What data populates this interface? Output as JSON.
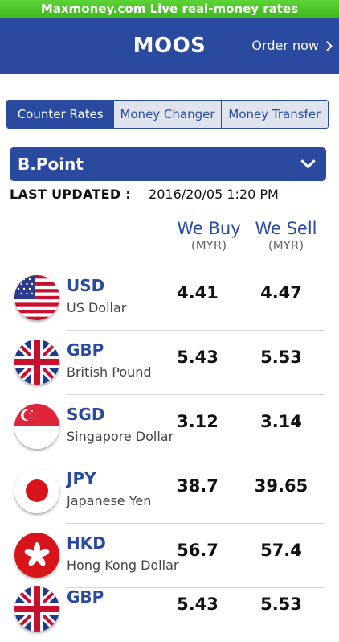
{
  "banner": "Maxmoney.com Live real-money rates",
  "header": {
    "title": "MOOS",
    "order_label": "Order now"
  },
  "tabs": [
    "Counter Rates",
    "Money Changer",
    "Money Transfer"
  ],
  "branch": "B.Point",
  "last_updated": {
    "label": "LAST UPDATED :",
    "value": "2016/20/05 1:20 PM"
  },
  "columns": {
    "buy": {
      "title": "We Buy",
      "unit": "(MYR)"
    },
    "sell": {
      "title": "We Sell",
      "unit": "(MYR)"
    }
  },
  "rates": [
    {
      "code": "USD",
      "name": "US Dollar",
      "buy": "4.41",
      "sell": "4.47",
      "flag": "us-flag-icon"
    },
    {
      "code": "GBP",
      "name": "British Pound",
      "buy": "5.43",
      "sell": "5.53",
      "flag": "uk-flag-icon"
    },
    {
      "code": "SGD",
      "name": "Singapore Dollar",
      "buy": "3.12",
      "sell": "3.14",
      "flag": "singapore-flag-icon"
    },
    {
      "code": "JPY",
      "name": "Japanese Yen",
      "buy": "38.7",
      "sell": "39.65",
      "flag": "japan-flag-icon"
    },
    {
      "code": "HKD",
      "name": "Hong Kong Dollar",
      "buy": "56.7",
      "sell": "57.4",
      "flag": "hong-kong-flag-icon"
    },
    {
      "code": "GBP",
      "name": "",
      "buy": "5.43",
      "sell": "5.53",
      "flag": "uk-flag-icon"
    }
  ],
  "colors": {
    "primary": "#2a4aa0",
    "banner": "#4cc52a"
  }
}
